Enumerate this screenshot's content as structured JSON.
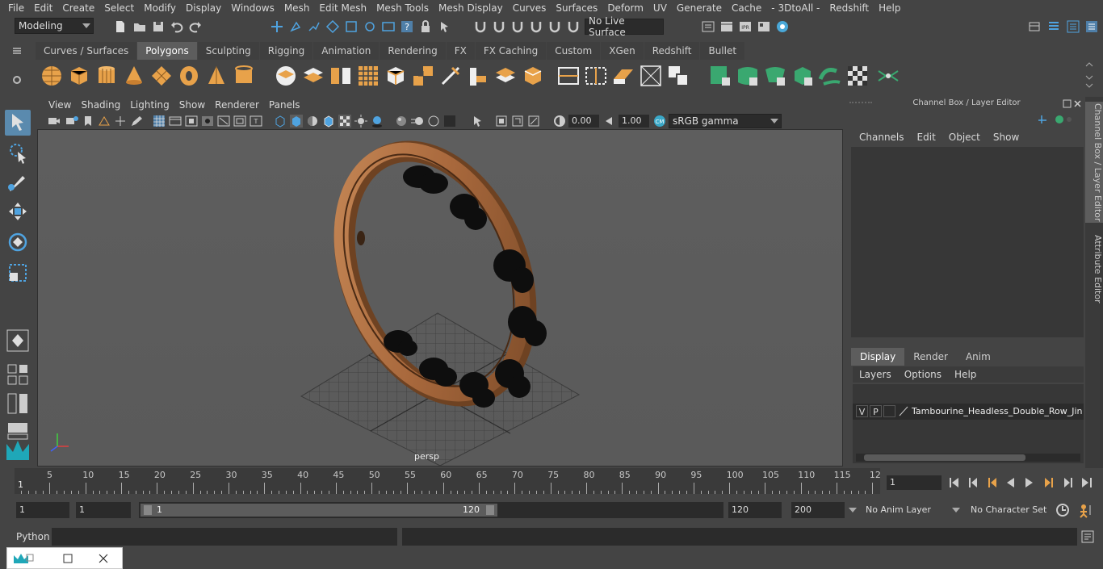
{
  "menu": [
    "File",
    "Edit",
    "Create",
    "Select",
    "Modify",
    "Display",
    "Windows",
    "Mesh",
    "Edit Mesh",
    "Mesh Tools",
    "Mesh Display",
    "Curves",
    "Surfaces",
    "Deform",
    "UV",
    "Generate",
    "Cache",
    "- 3DtoAll -",
    "Redshift",
    "Help"
  ],
  "status": {
    "mode": "Modeling",
    "live_surface": "No Live Surface"
  },
  "shelf_tabs": [
    "Curves / Surfaces",
    "Polygons",
    "Sculpting",
    "Rigging",
    "Animation",
    "Rendering",
    "FX",
    "FX Caching",
    "Custom",
    "XGen",
    "Redshift",
    "Bullet"
  ],
  "shelf_active": "Polygons",
  "viewport": {
    "menu": [
      "View",
      "Shading",
      "Lighting",
      "Show",
      "Renderer",
      "Panels"
    ],
    "exposure": "0.00",
    "gamma": "1.00",
    "colorspace": "sRGB gamma",
    "camera": "persp"
  },
  "channel_box": {
    "title": "Channel Box / Layer Editor",
    "menu": [
      "Channels",
      "Edit",
      "Object",
      "Show"
    ],
    "layer_tabs": [
      "Display",
      "Render",
      "Anim"
    ],
    "layer_menu": [
      "Layers",
      "Options",
      "Help"
    ],
    "layer": {
      "v": "V",
      "p": "P",
      "name": "Tambourine_Headless_Double_Row_Jing"
    }
  },
  "side_tabs": [
    "Channel Box / Layer Editor",
    "Attribute Editor"
  ],
  "timeline": {
    "ticks": [
      "5",
      "10",
      "15",
      "20",
      "25",
      "30",
      "35",
      "40",
      "45",
      "50",
      "55",
      "60",
      "65",
      "70",
      "75",
      "80",
      "85",
      "90",
      "95",
      "100",
      "105",
      "110",
      "115",
      "12"
    ],
    "start_marker": "1",
    "current_frame": "1"
  },
  "range": {
    "start": "1",
    "anim_start": "1",
    "slider_start": "1",
    "slider_end": "120",
    "end": "120",
    "anim_end": "200",
    "anim_layer": "No Anim Layer",
    "char_set": "No Character Set"
  },
  "python_label": "Python",
  "colors": {
    "accent": "#5a8aae",
    "shelf_green": "#3aa870",
    "shelf_orange": "#e8a24a",
    "wood": "#b87848"
  }
}
